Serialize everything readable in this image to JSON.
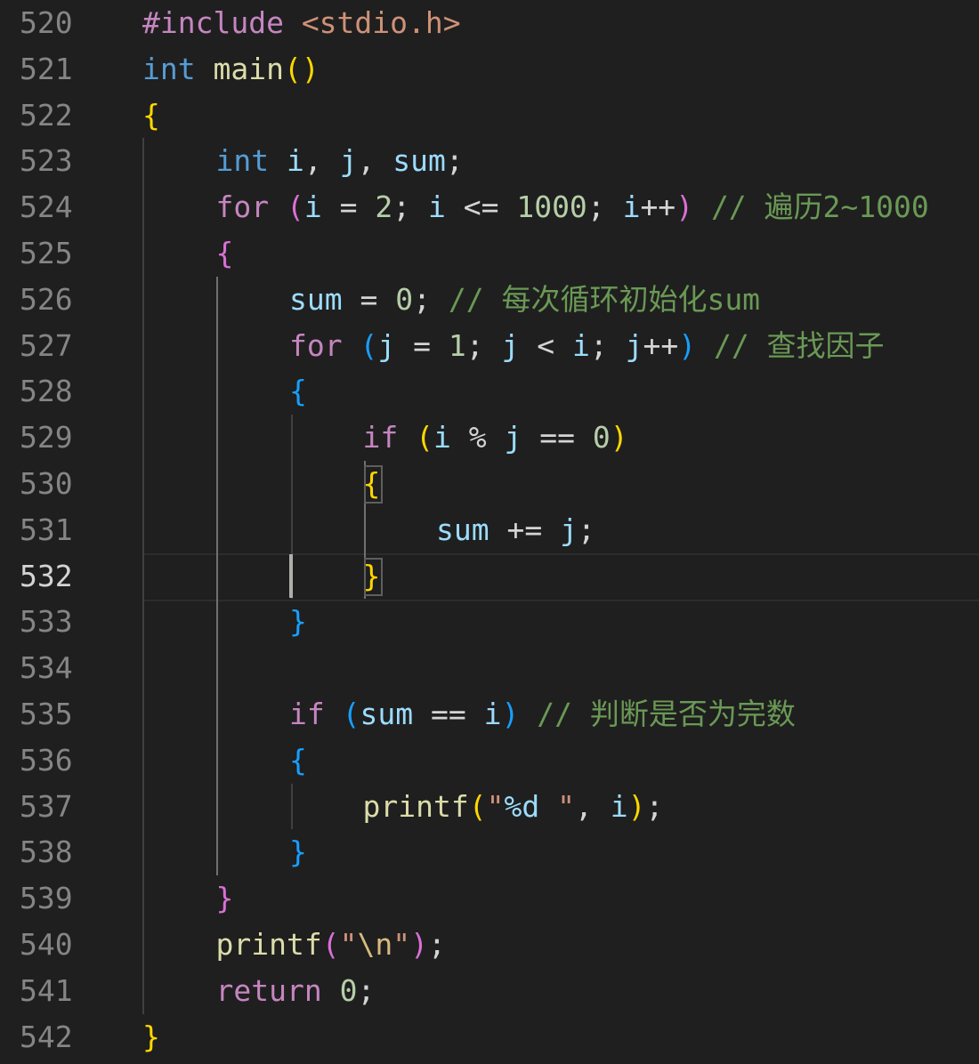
{
  "editor": {
    "language": "c",
    "active_line": "532",
    "colors": {
      "background": "#1f1f1f",
      "line_number": "#858585",
      "line_number_active": "#d4d4d4",
      "keyword": "#569cd6",
      "control": "#c586c0",
      "variable": "#9cdcfe",
      "number": "#b5cea8",
      "function": "#dcdcaa",
      "string": "#ce9178",
      "comment": "#6a9955",
      "bracket_level_1": "#ffd700",
      "bracket_level_2": "#da70d6",
      "bracket_level_3": "#179fff"
    },
    "lines": [
      {
        "number": "520",
        "indent": 0,
        "tokens": [
          {
            "text": "#include ",
            "type": "pp"
          },
          {
            "text": "<stdio.h>",
            "type": "str"
          }
        ]
      },
      {
        "number": "521",
        "indent": 0,
        "tokens": [
          {
            "text": "int",
            "type": "kw"
          },
          {
            "text": " ",
            "type": "op"
          },
          {
            "text": "main",
            "type": "fn"
          },
          {
            "text": "(",
            "type": "b1"
          },
          {
            "text": ")",
            "type": "b1"
          }
        ]
      },
      {
        "number": "522",
        "indent": 0,
        "tokens": [
          {
            "text": "{",
            "type": "b1"
          }
        ]
      },
      {
        "number": "523",
        "indent": 1,
        "tokens": [
          {
            "text": "int",
            "type": "kw"
          },
          {
            "text": " ",
            "type": "op"
          },
          {
            "text": "i",
            "type": "var"
          },
          {
            "text": ", ",
            "type": "op"
          },
          {
            "text": "j",
            "type": "var"
          },
          {
            "text": ", ",
            "type": "op"
          },
          {
            "text": "sum",
            "type": "var"
          },
          {
            "text": ";",
            "type": "op"
          }
        ]
      },
      {
        "number": "524",
        "indent": 1,
        "tokens": [
          {
            "text": "for",
            "type": "ctrl"
          },
          {
            "text": " ",
            "type": "op"
          },
          {
            "text": "(",
            "type": "b2"
          },
          {
            "text": "i",
            "type": "var"
          },
          {
            "text": " = ",
            "type": "op"
          },
          {
            "text": "2",
            "type": "num"
          },
          {
            "text": "; ",
            "type": "op"
          },
          {
            "text": "i",
            "type": "var"
          },
          {
            "text": " <= ",
            "type": "op"
          },
          {
            "text": "1000",
            "type": "num"
          },
          {
            "text": "; ",
            "type": "op"
          },
          {
            "text": "i",
            "type": "var"
          },
          {
            "text": "++",
            "type": "op"
          },
          {
            "text": ")",
            "type": "b2"
          },
          {
            "text": " ",
            "type": "op"
          },
          {
            "text": "// 遍历2~1000",
            "type": "cm"
          }
        ]
      },
      {
        "number": "525",
        "indent": 1,
        "tokens": [
          {
            "text": "{",
            "type": "b2"
          }
        ]
      },
      {
        "number": "526",
        "indent": 2,
        "tokens": [
          {
            "text": "sum",
            "type": "var"
          },
          {
            "text": " = ",
            "type": "op"
          },
          {
            "text": "0",
            "type": "num"
          },
          {
            "text": "; ",
            "type": "op"
          },
          {
            "text": "// 每次循环初始化sum",
            "type": "cm"
          }
        ]
      },
      {
        "number": "527",
        "indent": 2,
        "tokens": [
          {
            "text": "for",
            "type": "ctrl"
          },
          {
            "text": " ",
            "type": "op"
          },
          {
            "text": "(",
            "type": "b3"
          },
          {
            "text": "j",
            "type": "var"
          },
          {
            "text": " = ",
            "type": "op"
          },
          {
            "text": "1",
            "type": "num"
          },
          {
            "text": "; ",
            "type": "op"
          },
          {
            "text": "j",
            "type": "var"
          },
          {
            "text": " < ",
            "type": "op"
          },
          {
            "text": "i",
            "type": "var"
          },
          {
            "text": "; ",
            "type": "op"
          },
          {
            "text": "j",
            "type": "var"
          },
          {
            "text": "++",
            "type": "op"
          },
          {
            "text": ")",
            "type": "b3"
          },
          {
            "text": " ",
            "type": "op"
          },
          {
            "text": "// 查找因子",
            "type": "cm"
          }
        ]
      },
      {
        "number": "528",
        "indent": 2,
        "tokens": [
          {
            "text": "{",
            "type": "b3"
          }
        ]
      },
      {
        "number": "529",
        "indent": 3,
        "tokens": [
          {
            "text": "if",
            "type": "ctrl"
          },
          {
            "text": " ",
            "type": "op"
          },
          {
            "text": "(",
            "type": "b1"
          },
          {
            "text": "i",
            "type": "var"
          },
          {
            "text": " % ",
            "type": "op"
          },
          {
            "text": "j",
            "type": "var"
          },
          {
            "text": " == ",
            "type": "op"
          },
          {
            "text": "0",
            "type": "num"
          },
          {
            "text": ")",
            "type": "b1"
          }
        ]
      },
      {
        "number": "530",
        "indent": 3,
        "tokens": [
          {
            "text": "{",
            "type": "b1"
          }
        ]
      },
      {
        "number": "531",
        "indent": 4,
        "tokens": [
          {
            "text": "sum",
            "type": "var"
          },
          {
            "text": " += ",
            "type": "op"
          },
          {
            "text": "j",
            "type": "var"
          },
          {
            "text": ";",
            "type": "op"
          }
        ]
      },
      {
        "number": "532",
        "indent": 3,
        "tokens": [
          {
            "text": "}",
            "type": "b1"
          }
        ]
      },
      {
        "number": "533",
        "indent": 2,
        "tokens": [
          {
            "text": "}",
            "type": "b3"
          }
        ]
      },
      {
        "number": "534",
        "indent": 0,
        "tokens": []
      },
      {
        "number": "535",
        "indent": 2,
        "tokens": [
          {
            "text": "if",
            "type": "ctrl"
          },
          {
            "text": " ",
            "type": "op"
          },
          {
            "text": "(",
            "type": "b3"
          },
          {
            "text": "sum",
            "type": "var"
          },
          {
            "text": " == ",
            "type": "op"
          },
          {
            "text": "i",
            "type": "var"
          },
          {
            "text": ")",
            "type": "b3"
          },
          {
            "text": " ",
            "type": "op"
          },
          {
            "text": "// 判断是否为完数",
            "type": "cm"
          }
        ]
      },
      {
        "number": "536",
        "indent": 2,
        "tokens": [
          {
            "text": "{",
            "type": "b3"
          }
        ]
      },
      {
        "number": "537",
        "indent": 3,
        "tokens": [
          {
            "text": "printf",
            "type": "fn"
          },
          {
            "text": "(",
            "type": "b1"
          },
          {
            "text": "\"",
            "type": "str"
          },
          {
            "text": "%d",
            "type": "var"
          },
          {
            "text": " \"",
            "type": "str"
          },
          {
            "text": ", ",
            "type": "op"
          },
          {
            "text": "i",
            "type": "var"
          },
          {
            "text": ")",
            "type": "b1"
          },
          {
            "text": ";",
            "type": "op"
          }
        ]
      },
      {
        "number": "538",
        "indent": 2,
        "tokens": [
          {
            "text": "}",
            "type": "b3"
          }
        ]
      },
      {
        "number": "539",
        "indent": 1,
        "tokens": [
          {
            "text": "}",
            "type": "b2"
          }
        ]
      },
      {
        "number": "540",
        "indent": 1,
        "tokens": [
          {
            "text": "printf",
            "type": "fn"
          },
          {
            "text": "(",
            "type": "b2"
          },
          {
            "text": "\"",
            "type": "str"
          },
          {
            "text": "\\n",
            "type": "esc"
          },
          {
            "text": "\"",
            "type": "str"
          },
          {
            "text": ")",
            "type": "b2"
          },
          {
            "text": ";",
            "type": "op"
          }
        ]
      },
      {
        "number": "541",
        "indent": 1,
        "tokens": [
          {
            "text": "return",
            "type": "ctrl"
          },
          {
            "text": " ",
            "type": "op"
          },
          {
            "text": "0",
            "type": "num"
          },
          {
            "text": ";",
            "type": "op"
          }
        ]
      },
      {
        "number": "542",
        "indent": 0,
        "tokens": [
          {
            "text": "}",
            "type": "b1"
          }
        ]
      }
    ]
  }
}
